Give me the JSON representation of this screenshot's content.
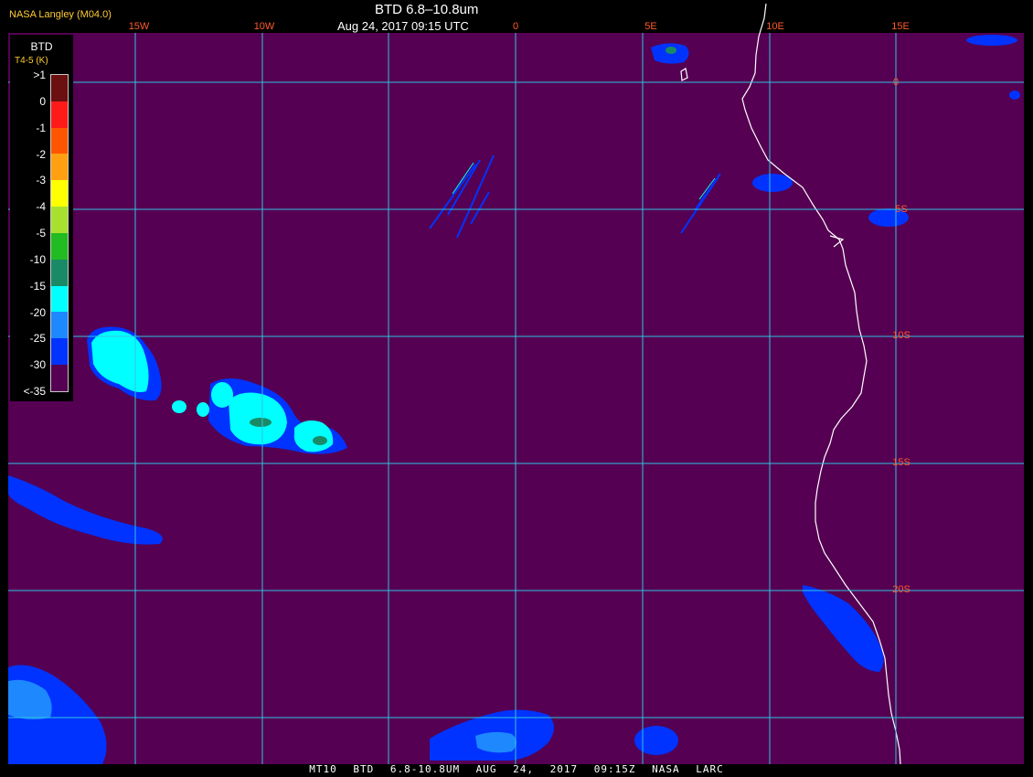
{
  "header": {
    "provider": "NASA Langley (M04.0)",
    "title": "BTD 6.8–10.8um",
    "datetime": "Aug 24, 2017 09:15 UTC"
  },
  "footer": "MT10  BTD 6.8-10.8UM  AUG 24, 2017 09:15Z  NASA LARC",
  "colors": {
    "background": "#550052",
    "grid": "#2fc4e0",
    "coast": "#ffffff",
    "label": "#ff5a2a",
    "cloud_cyan": "#00ffff",
    "cloud_blue": "#0033ff",
    "cloud_light_blue": "#1e88ff",
    "cloud_green": "#1a8a66"
  },
  "grid": {
    "lon_labels": [
      "15W",
      "10W",
      "0",
      "5E",
      "10E",
      "15E"
    ],
    "lat_labels": [
      "0",
      "5S",
      "10S",
      "15S",
      "20S"
    ]
  },
  "legend": {
    "title": "BTD",
    "subtitle": "T4-5 (K)",
    "ticks": [
      ">1",
      "0",
      "-1",
      "-2",
      "-3",
      "-4",
      "-5",
      "-10",
      "-15",
      "-20",
      "-25",
      "-30",
      "<-35"
    ],
    "bins": [
      {
        "color": "#6b0f10"
      },
      {
        "color": "#ff1a1a"
      },
      {
        "color": "#ff5500"
      },
      {
        "color": "#ffa010"
      },
      {
        "color": "#ffff00"
      },
      {
        "color": "#a8e030"
      },
      {
        "color": "#22bb22"
      },
      {
        "color": "#1a8a66"
      },
      {
        "color": "#00ffff"
      },
      {
        "color": "#1e88ff"
      },
      {
        "color": "#0033ff"
      },
      {
        "color": "#550052"
      }
    ]
  }
}
